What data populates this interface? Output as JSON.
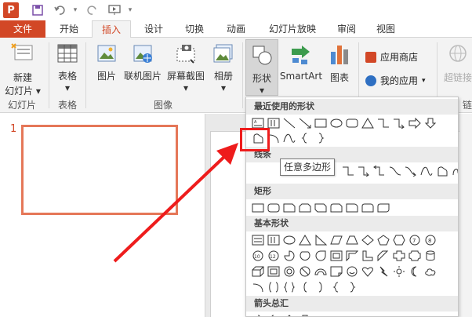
{
  "quick_access": {
    "app": "P",
    "save": "save-icon",
    "undo": "undo-icon",
    "redo": "redo-icon",
    "present": "present-icon",
    "more": "▾"
  },
  "tabs": [
    "文件",
    "开始",
    "插入",
    "设计",
    "切换",
    "动画",
    "幻灯片放映",
    "审阅",
    "视图"
  ],
  "active_tab": "插入",
  "ribbon": {
    "new_slide_line1": "新建",
    "new_slide_line2": "幻灯片",
    "table": "表格",
    "picture": "图片",
    "online_picture": "联机图片",
    "screenshot": "屏幕截图",
    "album": "相册",
    "shapes": "形状",
    "smartart": "SmartArt",
    "chart": "图表",
    "app_store": "应用商店",
    "my_apps": "我的应用",
    "hyperlink": "超链接",
    "group_slides": "幻灯片",
    "group_tables": "表格",
    "group_images": "图像",
    "group_links": "链"
  },
  "slide_number": "1",
  "dropdown": {
    "recent": "最近使用的形状",
    "lines": "线条",
    "rectangles": "矩形",
    "basic": "基本形状",
    "arrows": "箭头总汇"
  },
  "tooltip": "任意多边形",
  "colors": {
    "brand": "#d24726",
    "highlight": "#ee1c1c",
    "thumb_border": "#e57758"
  }
}
